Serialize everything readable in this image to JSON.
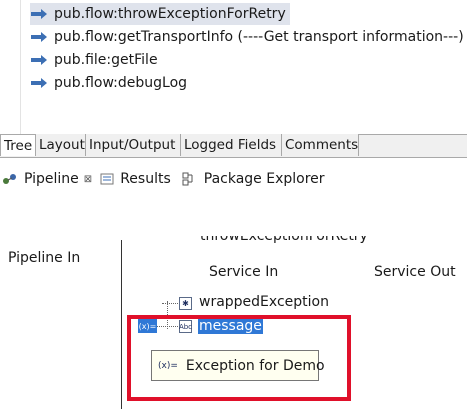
{
  "flow_steps": [
    {
      "label": "pub.flow:throwExceptionForRetry",
      "selected": true
    },
    {
      "label": "pub.flow:getTransportInfo (----Get transport information---)",
      "selected": false
    },
    {
      "label": "pub.file:getFile",
      "selected": false
    },
    {
      "label": "pub.flow:debugLog",
      "selected": false
    }
  ],
  "editor_tabs": [
    "Tree",
    "Layout",
    "Input/Output",
    "Logged Fields",
    "Comments"
  ],
  "view_tabs": {
    "pipeline": "Pipeline",
    "pipeline_close": "⊠",
    "results": "Results",
    "package_explorer": "Package Explorer"
  },
  "pipeline": {
    "pipeline_in": "Pipeline In",
    "service_name": "throwExceptionForRetry",
    "service_in": "Service In",
    "service_out": "Service Out",
    "fields": [
      "wrappedException",
      "message"
    ],
    "tooltip": "Exception for Demo"
  },
  "colors": {
    "selection_blue": "#2f78d6",
    "annotation_red": "#e0102a",
    "arrow_blue": "#3c6fb4"
  }
}
